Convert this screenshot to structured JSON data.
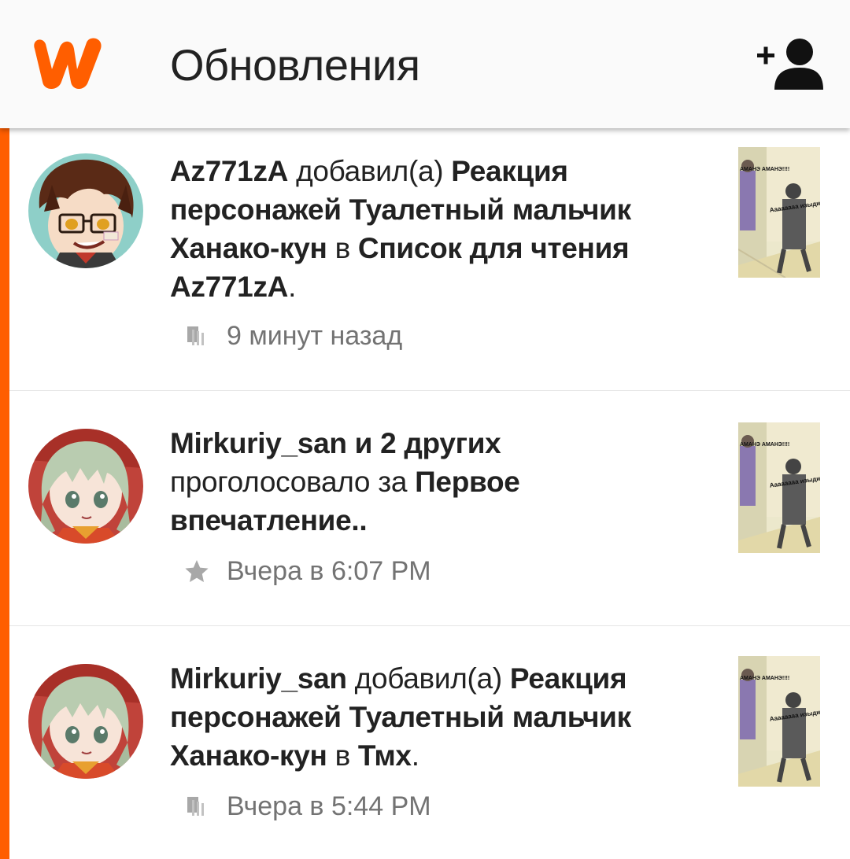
{
  "header": {
    "title": "Обновления",
    "brand_color": "#ff5e00"
  },
  "feed": {
    "accent_color": "#ff5e00",
    "items": [
      {
        "user": "Az771zA",
        "action": "добавил(а)",
        "story": "Реакция персонажей Туалетный мальчик Ханако-кун",
        "connector": "в",
        "target": "Список для чтения Az771zA",
        "end": ".",
        "meta_icon": "reading-list-icon",
        "time": "9 минут назад",
        "thumb_caption_top": "АМАНЭ АМАНЭ!!!!",
        "thumb_caption_side": "Аааааааа изыди!!!!"
      },
      {
        "user": "Mirkuriy_san",
        "others": "и 2 других",
        "action": "проголосовало за",
        "story": "Первое впечатление..",
        "meta_icon": "star-icon",
        "time": "Вчера в 6:07 PM",
        "thumb_caption_top": "АМАНЭ АМАНЭ!!!!",
        "thumb_caption_side": "Аааааааа изыди!!!!"
      },
      {
        "user": "Mirkuriy_san",
        "action": "добавил(а)",
        "story": "Реакция персонажей Туалетный мальчик Ханако-кун",
        "connector": "в",
        "target": "Тмх",
        "end": ".",
        "meta_icon": "reading-list-icon",
        "time": "Вчера в 5:44 PM",
        "thumb_caption_top": "АМАНЭ АМАНЭ!!!!",
        "thumb_caption_side": "Аааааааа изыди!!!!"
      }
    ]
  }
}
